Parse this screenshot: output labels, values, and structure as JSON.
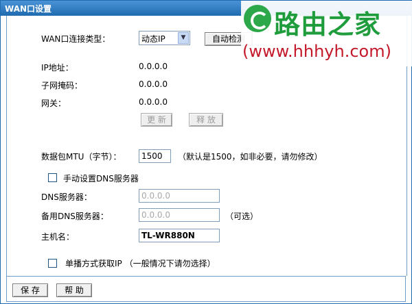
{
  "window": {
    "title": "WAN口设置"
  },
  "wan": {
    "type_label": "WAN口连接类型：",
    "type_value": "动态IP",
    "auto_detect": "自动检测"
  },
  "status": {
    "ip_label": "IP地址：",
    "ip_value": "0.0.0.0",
    "mask_label": "子网掩码：",
    "mask_value": "0.0.0.0",
    "gateway_label": "网关：",
    "gateway_value": "0.0.0.0",
    "renew_button": "更 新",
    "release_button": "释 放"
  },
  "mtu": {
    "label": "数据包MTU（字节）：",
    "value": "1500",
    "hint": "（默认是1500，如非必要，请勿修改）"
  },
  "dns": {
    "manual_label": "手动设置DNS服务器",
    "manual_checked": false,
    "primary_label": "DNS服务器：",
    "primary_value": "0.0.0.0",
    "secondary_label": "备用DNS服务器：",
    "secondary_value": "0.0.0.0",
    "optional_hint": "（可选）"
  },
  "host": {
    "label": "主机名：",
    "value": "TL-WR880N"
  },
  "unicast": {
    "label": "单播方式获取IP （一般情况下请勿选择）",
    "checked": false
  },
  "footer": {
    "save_button": "保 存",
    "help_button": "帮 助"
  },
  "watermark": {
    "brand": "路由之家",
    "url": "(www.hhhyh.com)"
  },
  "colors": {
    "title_bar": "#1f6bb0",
    "brand_green": "#1f9d3d",
    "url_red": "#c4182b"
  }
}
